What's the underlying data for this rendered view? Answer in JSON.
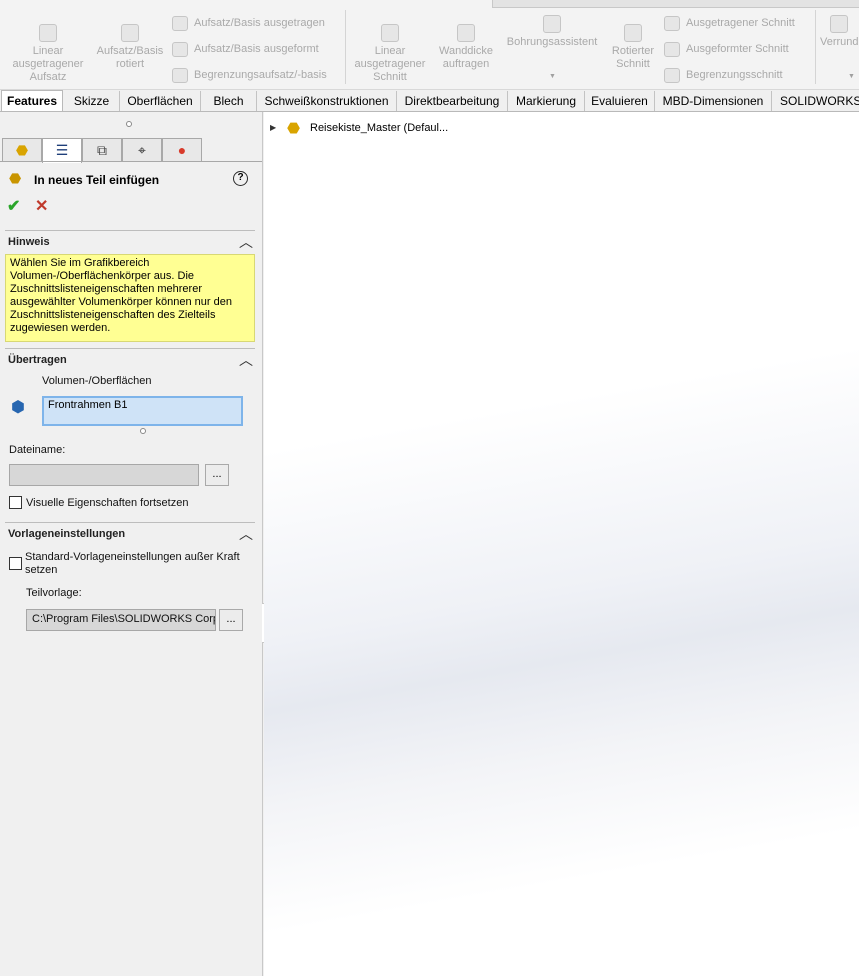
{
  "ribbon": {
    "buttons": [
      {
        "label": "Linear ausgetragener Aufsatz",
        "icon": "extruded-boss-icon"
      },
      {
        "label": "Aufsatz/Basis rotiert",
        "icon": "revolved-boss-icon"
      },
      {
        "label": "Linear ausgetragener Schnitt",
        "icon": "extruded-cut-icon"
      },
      {
        "label": "Wanddicke auftragen",
        "icon": "thicken-icon"
      },
      {
        "label": "Bohrungsassistent",
        "icon": "hole-wizard-icon"
      },
      {
        "label": "Rotierter Schnitt",
        "icon": "revolved-cut-icon"
      },
      {
        "label": "Verrund",
        "icon": "fillet-icon"
      }
    ],
    "small_buttons": [
      {
        "label": "Aufsatz/Basis ausgetragen",
        "icon": "swept-boss-icon"
      },
      {
        "label": "Aufsatz/Basis ausgeformt",
        "icon": "lofted-boss-icon"
      },
      {
        "label": "Begrenzungsaufsatz/-basis",
        "icon": "boundary-boss-icon"
      },
      {
        "label": "Ausgetragener Schnitt",
        "icon": "swept-cut-icon"
      },
      {
        "label": "Ausgeformter Schnitt",
        "icon": "lofted-cut-icon"
      },
      {
        "label": "Begrenzungsschnitt",
        "icon": "boundary-cut-icon"
      }
    ]
  },
  "tabs": [
    "Features",
    "Skizze",
    "Oberflächen",
    "Blech",
    "Schweißkonstruktionen",
    "Direktbearbeitung",
    "Markierung",
    "Evaluieren",
    "MBD-Dimensionen",
    "SOLIDWORKS Z"
  ],
  "panel": {
    "title": "In neues Teil einfügen",
    "help": "?",
    "ok": "✔",
    "cancel": "✕",
    "hint_section": {
      "title": "Hinweis",
      "text": "Wählen Sie im Grafikbereich Volumen-/Oberflächenkörper aus. Die Zuschnittslisteneigenschaften mehrerer ausgewählter Volumenkörper können nur den Zuschnittslisteneigenschaften des Zielteils zugewiesen werden."
    },
    "transfer_section": {
      "title": "Übertragen",
      "bodies_label": "Volumen-/Oberflächen",
      "selected_body": "Frontrahmen B1",
      "filename_label": "Dateiname:",
      "filename_value": "",
      "browse": "...",
      "visual_props_label": "Visuelle Eigenschaften fortsetzen"
    },
    "template_section": {
      "title": "Vorlageneinstellungen",
      "override_label": "Standard-Vorlageneinstellungen außer Kraft setzen",
      "part_template_label": "Teilvorlage:",
      "part_template_value": "C:\\Program Files\\SOLIDWORKS Corp",
      "browse": "..."
    }
  },
  "tree": {
    "root": "Reisekiste_Master  (Defaul..."
  }
}
